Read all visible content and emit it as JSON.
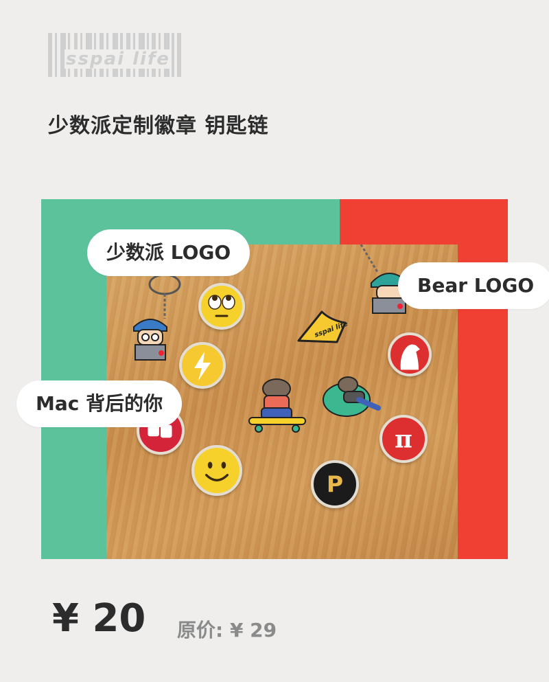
{
  "brand": {
    "logo_text": "sspai life"
  },
  "product": {
    "title": "少数派定制徽章 钥匙链"
  },
  "labels": {
    "logo": "少数派 LOGO",
    "bear": "Bear LOGO",
    "mac": "Mac 背后的你"
  },
  "pricing": {
    "price": "¥ 20",
    "original": "原价: ¥ 29"
  },
  "pins": {
    "sspai_badge_text": "sspai life",
    "pi_symbol": "π",
    "p_letter": "P"
  },
  "colors": {
    "background": "#efeeec",
    "green": "#5cc29c",
    "red": "#f04034",
    "text": "#2c2c2c",
    "muted": "#8a8a8a"
  }
}
